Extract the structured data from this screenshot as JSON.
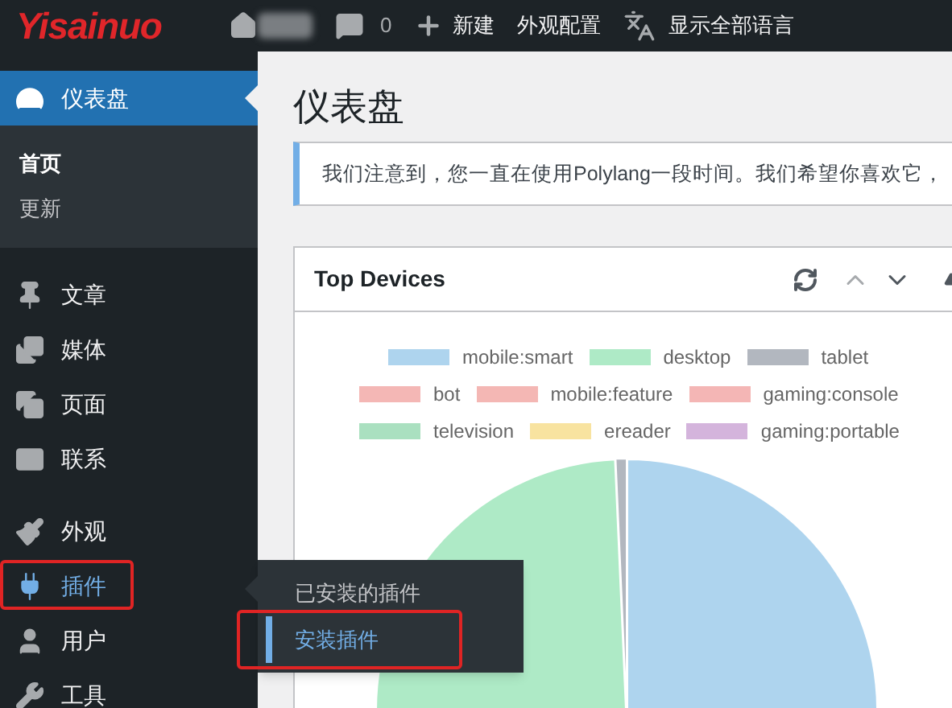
{
  "admin_bar": {
    "logo": "Yisainuo",
    "comments_count": "0",
    "items": [
      {
        "kind": "new",
        "label": "新建"
      },
      {
        "kind": "plain",
        "label": "外观配置"
      },
      {
        "kind": "language",
        "label": "显示全部语言"
      }
    ]
  },
  "sidebar": {
    "groups": [
      [
        {
          "kind": "dashboard",
          "label": "仪表盘",
          "selected": true,
          "highlighted": false,
          "children": [
            {
              "label": "首页",
              "selected": true
            },
            {
              "label": "更新",
              "selected": false
            }
          ]
        }
      ],
      [
        {
          "kind": "posts",
          "label": "文章",
          "selected": false,
          "highlighted": false
        },
        {
          "kind": "media",
          "label": "媒体",
          "selected": false,
          "highlighted": false
        },
        {
          "kind": "pages",
          "label": "页面",
          "selected": false,
          "highlighted": false
        },
        {
          "kind": "contact",
          "label": "联系",
          "selected": false,
          "highlighted": false
        }
      ],
      [
        {
          "kind": "appearance",
          "label": "外观",
          "selected": false,
          "highlighted": false
        },
        {
          "kind": "plugins",
          "label": "插件",
          "selected": false,
          "highlighted": true,
          "flyout": [
            {
              "label": "已安装的插件",
              "selected": false,
              "highlighted": false
            },
            {
              "label": "安装插件",
              "selected": true,
              "highlighted": true
            }
          ]
        },
        {
          "kind": "users",
          "label": "用户",
          "selected": false,
          "highlighted": false
        },
        {
          "kind": "tools",
          "label": "工具",
          "selected": false,
          "highlighted": false
        }
      ]
    ]
  },
  "page_title": "仪表盘",
  "notice": "我们注意到，您一直在使用Polylang一段时间。我们希望你喜欢它，",
  "widget": {
    "title": "Top Devices",
    "legend": [
      {
        "label": "mobile:smart",
        "color": "#aed4ee"
      },
      {
        "label": "desktop",
        "color": "#aeeac6"
      },
      {
        "label": "tablet",
        "color": "#b2b7bf"
      },
      {
        "label": "bot",
        "color": "#f4b7b5"
      },
      {
        "label": "mobile:feature",
        "color": "#f4b7b4"
      },
      {
        "label": "gaming:console",
        "color": "#f4b6b5"
      },
      {
        "label": "television",
        "color": "#aae0c0"
      },
      {
        "label": "ereader",
        "color": "#f8e3a0"
      },
      {
        "label": "gaming:portable",
        "color": "#d4b4dc"
      }
    ]
  }
}
